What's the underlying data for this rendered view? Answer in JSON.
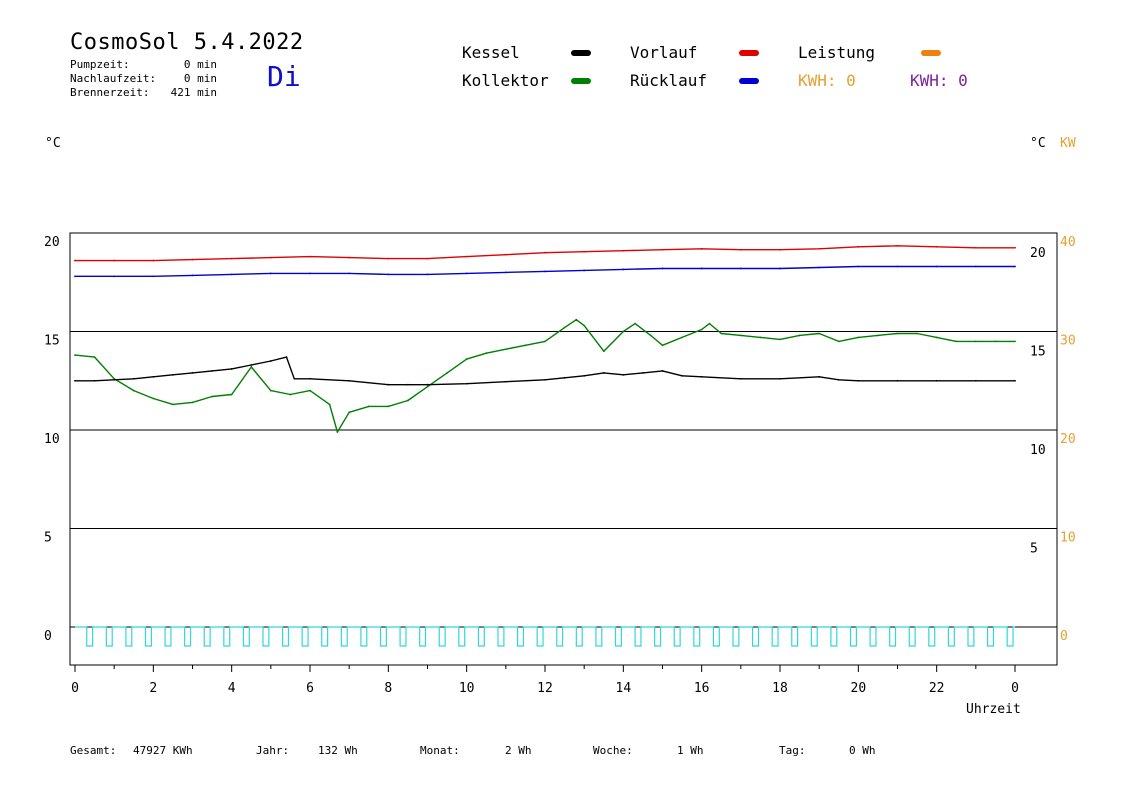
{
  "header": {
    "title": "CosmoSol 5.4.2022",
    "day": "Di",
    "stats": [
      {
        "label": "Pumpzeit:",
        "value": "0 min"
      },
      {
        "label": "Nachlaufzeit:",
        "value": "0 min"
      },
      {
        "label": "Brennerzeit:",
        "value": "421 min"
      }
    ]
  },
  "legend": {
    "kessel": "Kessel",
    "kollektor": "Kollektor",
    "vorlauf": "Vorlauf",
    "ruecklauf": "Rücklauf",
    "leistung": "Leistung",
    "kwh_orange": "KWH: 0",
    "kwh_purple": "KWH: 0"
  },
  "colors": {
    "kessel": "#000000",
    "kollektor": "#008000",
    "vorlauf": "#e00000",
    "ruecklauf": "#0000d0",
    "leistung": "#f08010",
    "kwh_purple": "#8020a0",
    "pump": "#30d8d8",
    "kw_axis": "#e8a030"
  },
  "axis": {
    "left_unit": "°C",
    "right_unit": "°C",
    "right_unit2": "KW",
    "xlabel": "Uhrzeit"
  },
  "footer": [
    {
      "label": "Gesamt:",
      "value": "47927 KWh"
    },
    {
      "label": "Jahr:",
      "value": "132 Wh"
    },
    {
      "label": "Monat:",
      "value": "2 Wh"
    },
    {
      "label": "Woche:",
      "value": "1 Wh"
    },
    {
      "label": "Tag:",
      "value": "0 Wh"
    }
  ],
  "chart_data": {
    "type": "line",
    "xlabel": "Uhrzeit",
    "ylabel": "°C",
    "x_ticks": [
      "0",
      "2",
      "4",
      "6",
      "8",
      "10",
      "12",
      "14",
      "16",
      "18",
      "20",
      "22",
      "0"
    ],
    "y_ticks_left": [
      20,
      15,
      10,
      5,
      0
    ],
    "y_ticks_right": [
      20,
      15,
      10,
      5
    ],
    "y_ticks_kw": [
      40,
      30,
      20,
      10,
      0
    ],
    "xlim": [
      0,
      24
    ],
    "ylim": [
      0,
      20
    ],
    "grid": "horizontal",
    "series": [
      {
        "name": "Vorlauf",
        "color": "#e00000",
        "x": [
          0,
          1,
          2,
          3,
          4,
          5,
          6,
          7,
          8,
          9,
          10,
          11,
          12,
          13,
          14,
          15,
          16,
          17,
          18,
          19,
          20,
          21,
          22,
          23,
          24
        ],
        "y": [
          18.6,
          18.6,
          18.6,
          18.65,
          18.7,
          18.75,
          18.8,
          18.75,
          18.7,
          18.7,
          18.8,
          18.9,
          19.0,
          19.05,
          19.1,
          19.15,
          19.2,
          19.15,
          19.15,
          19.2,
          19.3,
          19.35,
          19.3,
          19.25,
          19.25
        ]
      },
      {
        "name": "Rücklauf",
        "color": "#0000d0",
        "x": [
          0,
          1,
          2,
          3,
          4,
          5,
          6,
          7,
          8,
          9,
          10,
          11,
          12,
          13,
          14,
          15,
          16,
          17,
          18,
          19,
          20,
          21,
          22,
          23,
          24
        ],
        "y": [
          17.8,
          17.8,
          17.8,
          17.85,
          17.9,
          17.95,
          17.95,
          17.95,
          17.9,
          17.9,
          17.95,
          18.0,
          18.05,
          18.1,
          18.15,
          18.2,
          18.2,
          18.2,
          18.2,
          18.25,
          18.3,
          18.3,
          18.3,
          18.3,
          18.3
        ]
      },
      {
        "name": "Kollektor",
        "color": "#008000",
        "x": [
          0,
          0.5,
          1,
          1.5,
          2,
          2.5,
          3,
          3.5,
          4,
          4.5,
          5,
          5.5,
          6,
          6.5,
          6.7,
          7,
          7.5,
          8,
          8.5,
          9,
          9.5,
          10,
          10.5,
          11,
          11.5,
          12,
          12.5,
          12.8,
          13,
          13.5,
          14,
          14.3,
          14.7,
          15,
          15.5,
          16,
          16.2,
          16.5,
          17,
          17.5,
          18,
          18.5,
          19,
          19.5,
          20,
          20.5,
          21,
          21.5,
          22,
          22.5,
          23,
          23.5,
          24
        ],
        "y": [
          13.8,
          13.7,
          12.6,
          12.0,
          11.6,
          11.3,
          11.4,
          11.7,
          11.8,
          13.2,
          12.0,
          11.8,
          12.0,
          11.3,
          9.9,
          10.9,
          11.2,
          11.2,
          11.5,
          12.2,
          12.9,
          13.6,
          13.9,
          14.1,
          14.3,
          14.5,
          15.2,
          15.6,
          15.3,
          14.0,
          15.0,
          15.4,
          14.8,
          14.3,
          14.7,
          15.1,
          15.4,
          14.9,
          14.8,
          14.7,
          14.6,
          14.8,
          14.9,
          14.5,
          14.7,
          14.8,
          14.9,
          14.9,
          14.7,
          14.5,
          14.5,
          14.5,
          14.5
        ]
      },
      {
        "name": "Kessel",
        "color": "#000000",
        "x": [
          0,
          0.5,
          1,
          1.5,
          2,
          2.5,
          3,
          3.5,
          4,
          4.5,
          5,
          5.4,
          5.6,
          6,
          7,
          8,
          8.5,
          9,
          10,
          11,
          12,
          12.5,
          13,
          13.5,
          14,
          14.5,
          15,
          15.5,
          16,
          17,
          18,
          19,
          19.5,
          20,
          21,
          22,
          23,
          24
        ],
        "y": [
          12.5,
          12.5,
          12.55,
          12.6,
          12.7,
          12.8,
          12.9,
          13.0,
          13.1,
          13.3,
          13.5,
          13.7,
          12.6,
          12.6,
          12.5,
          12.3,
          12.3,
          12.3,
          12.35,
          12.45,
          12.55,
          12.65,
          12.75,
          12.9,
          12.8,
          12.9,
          13.0,
          12.75,
          12.7,
          12.6,
          12.6,
          12.7,
          12.55,
          12.5,
          12.5,
          12.5,
          12.5,
          12.5
        ]
      }
    ]
  }
}
